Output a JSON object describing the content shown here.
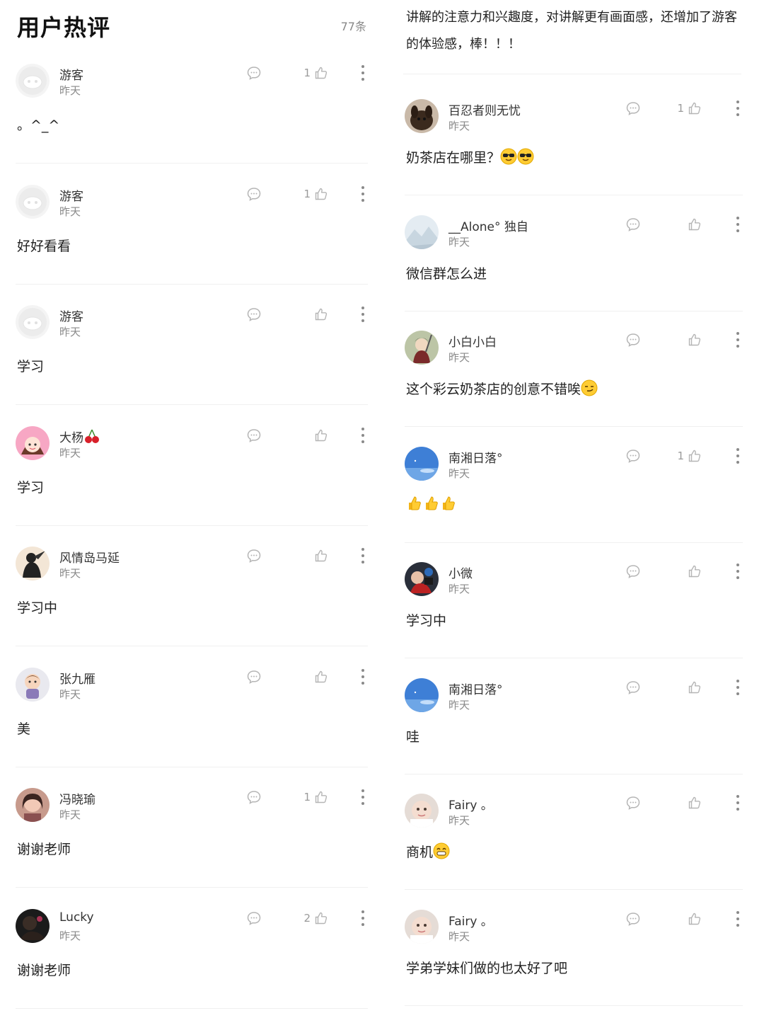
{
  "header": {
    "title": "用户热评",
    "count": "77条"
  },
  "continued_text": "讲解的注意力和兴趣度，对讲解更有画面感，还增加了游客的体验感，棒！！！",
  "left_comments": [
    {
      "user": "游客",
      "time": "昨天",
      "likes": "1",
      "text": "。^_^",
      "avatar": "guest"
    },
    {
      "user": "游客",
      "time": "昨天",
      "likes": "1",
      "text": "好好看看",
      "avatar": "guest"
    },
    {
      "user": "游客",
      "time": "昨天",
      "likes": "",
      "text": "学习",
      "avatar": "guest"
    },
    {
      "user": "大杨",
      "time": "昨天",
      "likes": "",
      "text": "学习",
      "avatar": "girl-pink",
      "name_emoji": "cherry"
    },
    {
      "user": "风情岛马延",
      "time": "昨天",
      "likes": "",
      "text": "学习中",
      "avatar": "silhouette"
    },
    {
      "user": "张九雁",
      "time": "昨天",
      "likes": "",
      "text": "美",
      "avatar": "cartoon"
    },
    {
      "user": "冯晓瑜",
      "time": "昨天",
      "likes": "1",
      "text": "谢谢老师",
      "avatar": "portrait"
    },
    {
      "user": "Lucky",
      "time": "昨天",
      "likes": "2",
      "text": "谢谢老师",
      "avatar": "dark"
    }
  ],
  "right_comments": [
    {
      "user": "百忍者则无忧",
      "time": "昨天",
      "likes": "1",
      "text": "奶茶店在哪里？",
      "avatar": "dog",
      "text_emoji": [
        "sunglasses",
        "sunglasses"
      ]
    },
    {
      "user": "__Alone° 独自",
      "time": "昨天",
      "likes": "",
      "text": "微信群怎么进",
      "avatar": "mountain"
    },
    {
      "user": "小白小白",
      "time": "昨天",
      "likes": "",
      "text": "这个彩云奶茶店的创意不错唉",
      "avatar": "warrior",
      "text_emoji": [
        "smirk"
      ]
    },
    {
      "user": "南湘日落°",
      "time": "昨天",
      "likes": "1",
      "text": "",
      "avatar": "sky",
      "text_emoji": [
        "thumbs",
        "thumbs",
        "thumbs"
      ]
    },
    {
      "user": "小微",
      "time": "昨天",
      "likes": "",
      "text": "学习中",
      "avatar": "colorful"
    },
    {
      "user": "南湘日落°",
      "time": "昨天",
      "likes": "",
      "text": "哇",
      "avatar": "sky"
    },
    {
      "user": "Fairy 。",
      "time": "昨天",
      "likes": "",
      "text": "商机",
      "avatar": "baby",
      "text_emoji": [
        "grin"
      ]
    },
    {
      "user": "Fairy 。",
      "time": "昨天",
      "likes": "",
      "text": "学弟学妹们做的也太好了吧",
      "avatar": "baby"
    }
  ],
  "colors": {
    "accent_text": "#222222",
    "meta_text": "#8a8a8a",
    "icon": "#b5b5b5",
    "divider": "#f0f0f0"
  },
  "icons": {
    "reply": "comment-bubble-icon",
    "like": "thumbs-up-icon",
    "more": "more-vertical-icon"
  }
}
